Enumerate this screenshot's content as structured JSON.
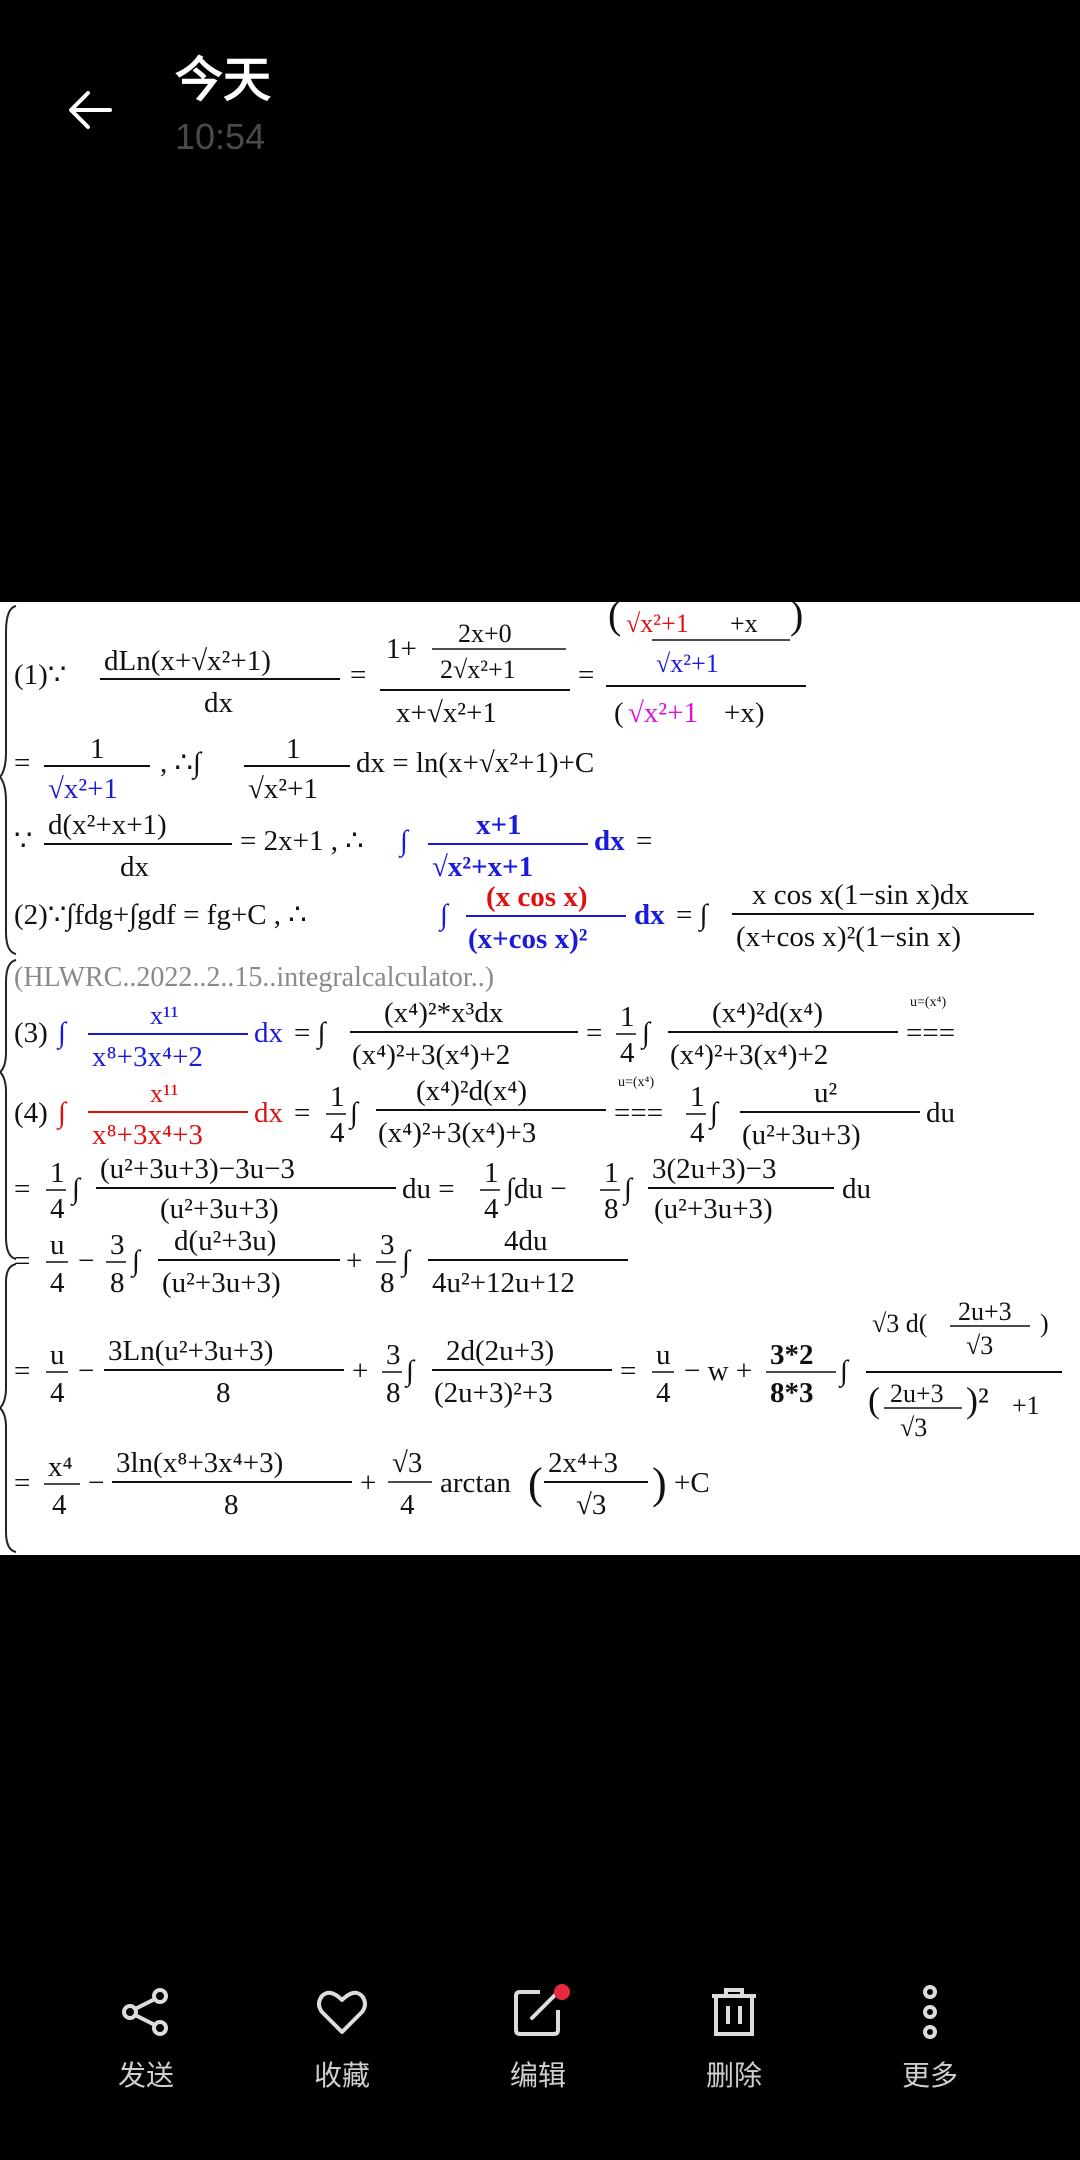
{
  "header": {
    "title": "今天",
    "time": "10:54"
  },
  "image": {
    "line_1": "(1) ∵ dLn(x + √(x² + 1)) / dx = (1 + (2x + 0)/(2√(x² + 1))) / (x + √(x² + 1)) = ((√(x² + 1) + x)/√(x² + 1)) / (√(x² + 1) + x)",
    "line_2": "= 1/√(x² + 1) , ∴ ∫ 1/√(x² + 1) dx = ln(x + √(x² + 1)) + C",
    "line_3": "∵ d(x² + x + 1)/dx = 2x + 1 , ∴ ∫ (x + 1)/√(x² + x + 1) dx =",
    "line_4": "(2) ∵ ∫fdg + ∫gdf = fg + C , ∴ ∫ (x cos x)/(x + cos x)² dx = ∫ x cos x (1 − sin x) dx / ((x + cos x)² (1 − sin x))",
    "watermark": "(HLWRC..2022..2..15..integralcalculator..)",
    "line_5": "(3) ∫ x¹¹/(x⁸ + 3x⁴ + 2) dx = ∫ (x⁴)² * x³dx / ((x⁴)² + 3(x⁴) + 2) = 1/4 ∫ (x⁴)²d(x⁴) / ((x⁴)² + 3(x⁴) + 2) ===",
    "line_6": "(4) ∫ x¹¹/(x⁸ + 3x⁴ + 3) dx = 1/4 ∫ (x⁴)²d(x⁴) / ((x⁴)² + 3(x⁴) + 3) === 1/4 ∫ u²/(u² + 3u + 3) du",
    "line_7": "= 1/4 ∫ ((u² + 3u + 3) − 3u − 3)/(u² + 3u + 3) du = 1/4 ∫ du − 1/8 ∫ (3(2u + 3) − 3)/(u² + 3u + 3) du",
    "line_8": "= u/4 − 3/8 ∫ d(u² + 3u)/(u² + 3u + 3) + 3/8 ∫ 4du/(4u² + 12u + 12)",
    "line_9": "= u/4 − 3Ln(u² + 3u + 3)/8 + 3/8 ∫ 2d(2u + 3)/((2u + 3)² + 3) = u/4 − w + 3*2/(8*3) ∫ √3 d((2u + 3)/√3) / (((2u + 3)/√3)² + 1)",
    "line_10": "= x⁴/4 − 3ln(x⁸ + 3x⁴ + 3)/8 + √3/4 arctan((2x⁴ + 3)/√3) + C",
    "subst_label": "u=(x⁴)"
  },
  "toolbar": {
    "share": "发送",
    "favorite": "收藏",
    "edit": "编辑",
    "delete": "删除",
    "more": "更多"
  },
  "colors": {
    "red": "#e01010",
    "blue": "#1a1adc",
    "magenta": "#e010e0",
    "gray": "#8a8a8a",
    "badge": "#e8283c"
  }
}
